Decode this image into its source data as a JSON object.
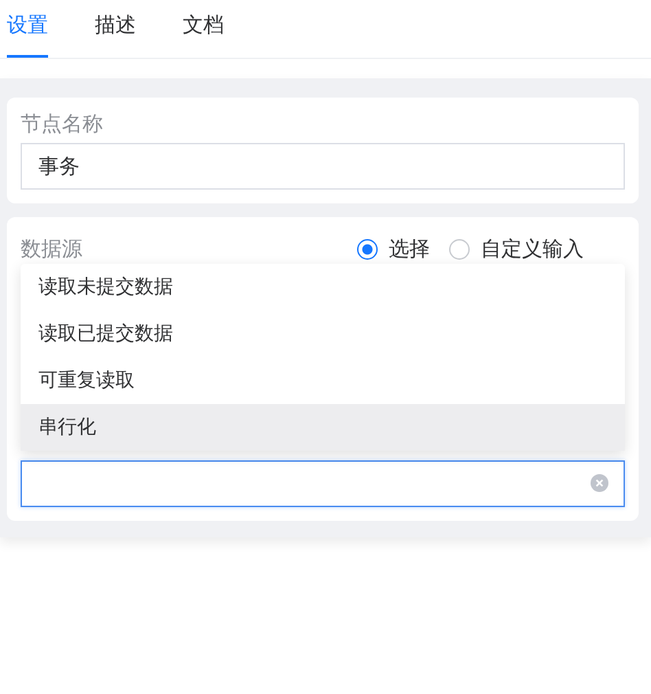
{
  "tabs": [
    {
      "label": "设置",
      "selected": true
    },
    {
      "label": "描述",
      "selected": false
    },
    {
      "label": "文档",
      "selected": false
    }
  ],
  "node_name": {
    "label": "节点名称",
    "value": "事务"
  },
  "data_source": {
    "label": "数据源",
    "options": [
      {
        "label": "选择",
        "selected": true
      },
      {
        "label": "自定义输入",
        "selected": false
      }
    ]
  },
  "dropdown": {
    "items": [
      {
        "label": "读取未提交数据",
        "selected": false
      },
      {
        "label": "读取已提交数据",
        "selected": false
      },
      {
        "label": "可重复读取",
        "selected": false
      },
      {
        "label": "串行化",
        "selected": true
      }
    ]
  },
  "select_field": {
    "clearable": true
  }
}
